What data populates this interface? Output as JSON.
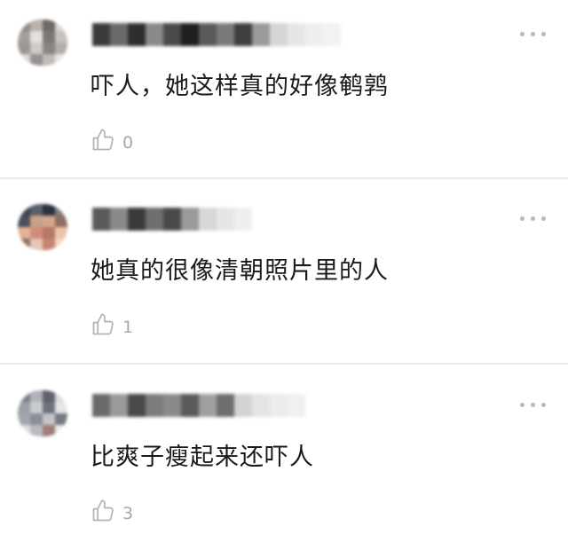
{
  "comments": [
    {
      "text": "吓人，她这样真的好像鹌鹑",
      "likes": "0",
      "avatar_colors": [
        "#8f8a86",
        "#b9b2ad",
        "#6f6a66",
        "#d9d5d2",
        "#a49f9b",
        "#e4e1df",
        "#7b7774",
        "#c7c2be",
        "#9a9692",
        "#cfcac6",
        "#8a8581",
        "#b3aeaa",
        "#dcd8d5",
        "#969190",
        "#c0bbb7",
        "#e8e6e4"
      ],
      "name_colors": [
        "#3a3a3a",
        "#6a6a6a",
        "#2e2e2e",
        "#8a8a8a",
        "#4a4a4a",
        "#1f1f1f",
        "#5a5a5a",
        "#7a7a7a",
        "#3f3f3f",
        "#9a9a9a",
        "#d6d6d6",
        "#e6e6e6",
        "#efefef",
        "#f2f2f2"
      ]
    },
    {
      "text": "她真的很像清朝照片里的人",
      "likes": "1",
      "avatar_colors": [
        "#3d4350",
        "#5a5f6a",
        "#2c3140",
        "#7a7e88",
        "#4a4f5c",
        "#c9a08a",
        "#d4a58d",
        "#8d6f62",
        "#e2b39a",
        "#cf8e77",
        "#b7776a",
        "#f0c2a8",
        "#9a6a5e",
        "#e6c6b5",
        "#c8846e",
        "#f3d5c4"
      ],
      "name_colors": [
        "#5a5a5a",
        "#8a8a8a",
        "#3a3a3a",
        "#6f6f6f",
        "#4a4a4a",
        "#9a9a9a",
        "#d8d8d8",
        "#e6e6e6",
        "#eeeeee"
      ]
    },
    {
      "text": "比爽子瘦起来还吓人",
      "likes": "3",
      "avatar_colors": [
        "#7c7f86",
        "#b0b3b8",
        "#5f626a",
        "#d8dadd",
        "#9aa0a8",
        "#c9ccd0",
        "#6e7279",
        "#e3e5e7",
        "#a2a6ad",
        "#8a8e95",
        "#c2c5ca",
        "#767a82",
        "#dcdee1",
        "#b7bbc0",
        "#9d7f75",
        "#e9ebed"
      ],
      "name_colors": [
        "#6a6a6a",
        "#9a9a9a",
        "#4a4a4a",
        "#7c7c7c",
        "#8a8a8a",
        "#5a5a5a",
        "#a0a0a0",
        "#6e6e6e",
        "#d2d2d2",
        "#e4e4e4",
        "#ececec",
        "#f0f0f0"
      ]
    }
  ],
  "colors": {
    "icon": "#b4b4b4",
    "count": "#a8a8a8",
    "divider": "#e9e9e9"
  }
}
